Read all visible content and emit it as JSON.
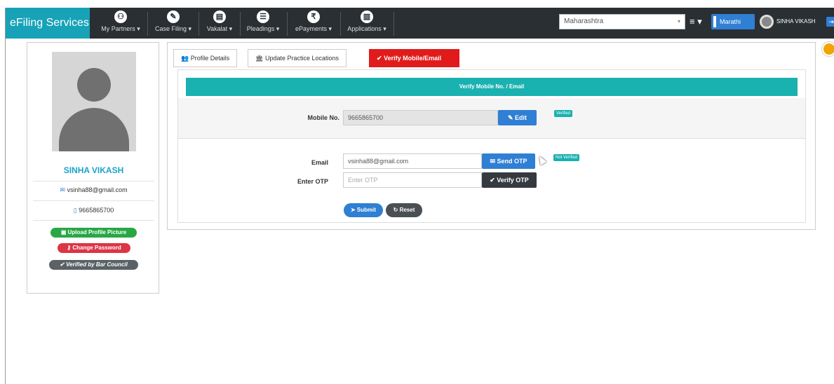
{
  "navbar": {
    "brand": "eFiling Services",
    "items": [
      {
        "label": "My Partners",
        "icon": "partners-icon",
        "glyph": "⚇"
      },
      {
        "label": "Case Filing",
        "icon": "case-filing-icon",
        "glyph": "✎"
      },
      {
        "label": "Vakalat",
        "icon": "vakalat-icon",
        "glyph": "▤"
      },
      {
        "label": "Pleadings",
        "icon": "pleadings-icon",
        "glyph": "☰"
      },
      {
        "label": "ePayments",
        "icon": "rupee-icon",
        "glyph": "₹"
      },
      {
        "label": "Applications",
        "icon": "applications-icon",
        "glyph": "▥"
      }
    ],
    "state_select": "Maharashtra",
    "language_button": "Marathi",
    "user_name": "SINHA VIKASH"
  },
  "profile": {
    "name": "SINHA VIKASH",
    "email": "vsinha88@gmail.com",
    "phone": "9665865700",
    "upload_button": "Upload Profile Picture",
    "change_password_button": "Change Password",
    "verified_badge": "Verified by Bar Council"
  },
  "tabs": [
    {
      "label": "Profile Details"
    },
    {
      "label": "Update Practice Locations"
    },
    {
      "label": "Verify Mobile/Email"
    }
  ],
  "form": {
    "heading": "Verify Mobile No. / Email",
    "mobile_label": "Mobile No.",
    "mobile_value": "9665865700",
    "edit_button": "Edit",
    "mobile_status": "Verified",
    "email_label": "Email",
    "email_value": "vsinha88@gmail.com",
    "send_otp_button": "Send OTP",
    "email_status": "Not Verified",
    "otp_label": "Enter OTP",
    "otp_placeholder": "Enter OTP",
    "verify_otp_button": "Verify OTP",
    "submit_button": "Submit",
    "reset_button": "Reset"
  },
  "colors": {
    "brand": "#17a2b8",
    "navbar": "#2a2f33",
    "active_tab": "#e11b1b",
    "teal": "#1ab1b1",
    "primary": "#2f7fd4",
    "success": "#28a745",
    "danger": "#dc3545",
    "dark": "#343a40"
  }
}
